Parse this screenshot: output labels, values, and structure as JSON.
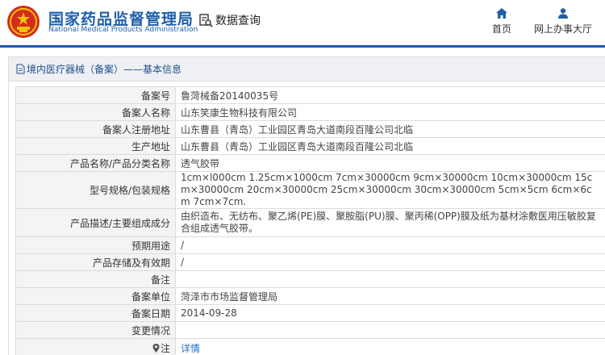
{
  "header": {
    "title_cn": "国家药品监督管理局",
    "title_en": "National Medical Products Administration",
    "data_query": "数据查询",
    "nav": [
      {
        "label": "首页",
        "icon": "home-icon"
      },
      {
        "label": "网上办事大厅",
        "icon": "user-icon"
      }
    ]
  },
  "colors": {
    "brand_blue": "#1f5fa8",
    "divider": "#1a5aa6",
    "link": "#1f6fc4"
  },
  "breadcrumb": "境内医疗器械（备案）——基本信息",
  "rows": [
    {
      "key": "备案号",
      "value": "鲁菏械备20140035号"
    },
    {
      "key": "备案人名称",
      "value": "山东笑康生物科技有限公司"
    },
    {
      "key": "备案人注册地址",
      "value": "山东曹县（青岛）工业园区青岛大道南段百隆公司北临"
    },
    {
      "key": "生产地址",
      "value": "山东曹县（青岛）工业园区青岛大道南段百隆公司北临"
    },
    {
      "key": "产品名称/产品分类名称",
      "value": "透气胶带"
    },
    {
      "key": "型号规格/包装规格",
      "value": "1cm×l000cm 1.25cm×1000cm 7cm×30000cm 9cm×30000cm 10cm×30000cm 15cm×30000cm 20cm×30000cm 25cm×30000cm 30cm×30000cm 5cm×5cm 6cm×6cm 7cm×7cm."
    },
    {
      "key": "产品描述/主要组成成分",
      "value": "由织造布、无纺布、聚乙烯(PE)膜、聚胺脂(PU)膜、聚丙稀(OPP)膜及纸为基材涂敷医用压敏胶复合组成透气胶带。"
    },
    {
      "key": "预期用途",
      "value": "/"
    },
    {
      "key": "产品存储及有效期",
      "value": "/"
    },
    {
      "key": "备注",
      "value": ""
    },
    {
      "key": "备案单位",
      "value": "菏泽市市场监督管理局"
    },
    {
      "key": "备案日期",
      "value": "2014-09-28"
    },
    {
      "key": "变更情况",
      "value": ""
    },
    {
      "key": "注",
      "value": "详情"
    }
  ]
}
